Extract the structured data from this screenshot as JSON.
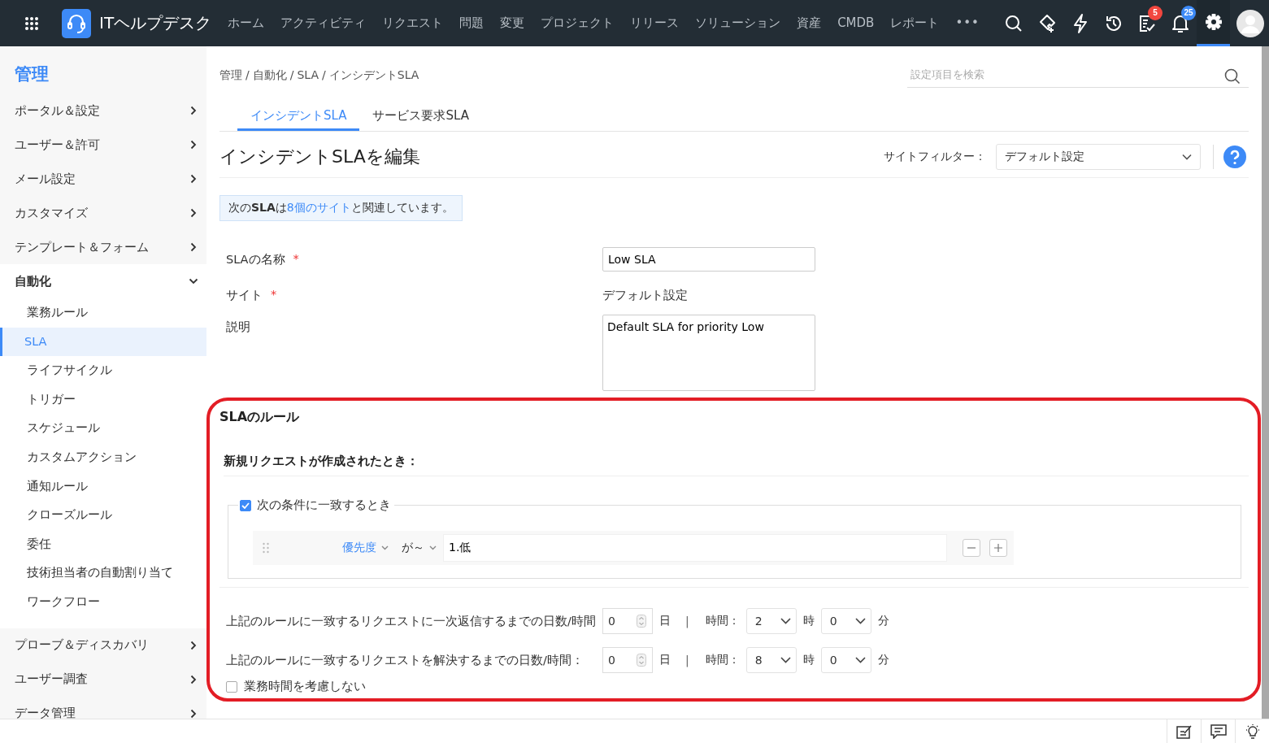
{
  "topbar": {
    "title": "ITヘルプデスク",
    "nav": [
      {
        "label": "ホーム"
      },
      {
        "label": "アクティビティ"
      },
      {
        "label": "リクエスト"
      },
      {
        "label": "問題"
      },
      {
        "label": "変更"
      },
      {
        "label": "プロジェクト"
      },
      {
        "label": "リリース"
      },
      {
        "label": "ソリューション"
      },
      {
        "label": "資産"
      },
      {
        "label": "CMDB"
      },
      {
        "label": "レポート"
      }
    ],
    "more": "•••",
    "tools": [
      {
        "kind": "search",
        "selected": false
      },
      {
        "kind": "ticket",
        "selected": false
      },
      {
        "kind": "bolt",
        "selected": false
      },
      {
        "kind": "history",
        "selected": false
      },
      {
        "kind": "tasks",
        "selected": false,
        "badge": "5",
        "color": "#f2473f"
      },
      {
        "kind": "bell",
        "selected": false,
        "badge": "25",
        "color": "#3d8af7"
      },
      {
        "kind": "gear",
        "selected": true
      }
    ]
  },
  "sidebar": {
    "title": "管理",
    "items": [
      {
        "label": "ポータル＆設定",
        "expanded": false
      },
      {
        "label": "ユーザー＆許可",
        "expanded": false
      },
      {
        "label": "メール設定",
        "expanded": false
      },
      {
        "label": "カスタマイズ",
        "expanded": false
      },
      {
        "label": "テンプレート＆フォーム",
        "expanded": false
      },
      {
        "label": "自動化",
        "expanded": true,
        "children": [
          {
            "label": "業務ルール",
            "selected": false
          },
          {
            "label": "SLA",
            "selected": true
          },
          {
            "label": "ライフサイクル",
            "selected": false
          },
          {
            "label": "トリガー",
            "selected": false
          },
          {
            "label": "スケジュール",
            "selected": false
          },
          {
            "label": "カスタムアクション",
            "selected": false
          },
          {
            "label": "通知ルール",
            "selected": false
          },
          {
            "label": "クローズルール",
            "selected": false
          },
          {
            "label": "委任",
            "selected": false
          },
          {
            "label": "技術担当者の自動割り当て",
            "selected": false
          },
          {
            "label": "ワークフロー",
            "selected": false
          }
        ]
      },
      {
        "label": "プローブ＆ディスカバリ",
        "expanded": false
      },
      {
        "label": "ユーザー調査",
        "expanded": false
      },
      {
        "label": "データ管理",
        "expanded": false
      }
    ]
  },
  "breadcrumb": [
    {
      "label": "管理"
    },
    {
      "separator": "/",
      "label": "自動化"
    },
    {
      "separator": "/",
      "label": "SLA"
    },
    {
      "separator": "/",
      "label": "インシデントSLA"
    }
  ],
  "search": {
    "placeholder": "設定項目を検索"
  },
  "tabs": [
    {
      "label": "インシデントSLA",
      "selected": true
    },
    {
      "label": "サービス要求SLA",
      "selected": false
    }
  ],
  "heading": "インシデントSLAを編集",
  "site_filter": {
    "label": "サイトフィルター：",
    "value": "デフォルト設定"
  },
  "note": {
    "text": "次の**SLA**は",
    "link": "8個のサイト",
    "suffix": " と関連しています。"
  },
  "form": [
    {
      "kind": "input",
      "label": "SLAの名称",
      "required_mark": "*",
      "value": "Low SLA"
    },
    {
      "kind": "text",
      "label": "サイト",
      "required_mark": "*",
      "value": "デフォルト設定"
    },
    {
      "kind": "textarea",
      "label": "説明",
      "value": "Default SLA for priority Low"
    }
  ],
  "rules": {
    "title": "SLAのルール",
    "subtitle": "新規リクエストが作成されたとき：",
    "condition": {
      "label": "次の条件に一致するとき",
      "checked": true,
      "field": "優先度",
      "operator": "が～",
      "value": "1.低"
    },
    "timings": [
      {
        "label": "上記のルールに一致するリクエストに一次返信するまでの日数/時間",
        "days": "0",
        "days_unit": "日",
        "separator": "|",
        "hours_label": "時間：",
        "hours": "2",
        "hours_unit": "時",
        "minutes": "0",
        "minutes_unit": "分"
      },
      {
        "label": "上記のルールに一致するリクエストを解決するまでの日数/時間：",
        "days": "0",
        "days_unit": "日",
        "separator": "|",
        "hours_label": "時間：",
        "hours": "8",
        "hours_unit": "時",
        "minutes": "0",
        "minutes_unit": "分"
      }
    ],
    "ignore_hours": {
      "label": "業務時間を考慮しない",
      "checked": false
    }
  },
  "footer_tools": [
    {
      "kind": "note"
    },
    {
      "kind": "chat"
    },
    {
      "kind": "bulb"
    }
  ]
}
